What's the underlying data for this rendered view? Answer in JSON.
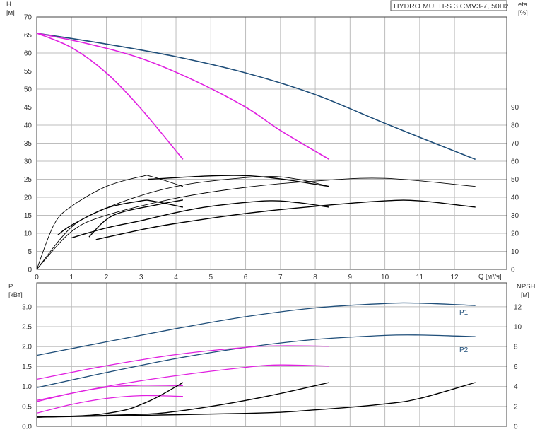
{
  "chart_data": [
    {
      "type": "line",
      "title": "HYDRO MULTI-S 3 CMV3-7, 50Hz",
      "xlabel": "Q [м³/ч]",
      "ylabel_left": "H",
      "ylabel_left_unit": "[м]",
      "ylabel_right": "eta",
      "ylabel_right_unit": "[%]",
      "xlim": [
        0,
        13.5
      ],
      "ylim_left": [
        0,
        70
      ],
      "ylim_right": [
        0,
        140
      ],
      "xticks": [
        "0",
        "1",
        "2",
        "3",
        "4",
        "5",
        "6",
        "7",
        "8",
        "9",
        "10",
        "11",
        "12"
      ],
      "yticks_left": [
        "0",
        "5",
        "10",
        "15",
        "20",
        "25",
        "30",
        "35",
        "40",
        "45",
        "50",
        "55",
        "60",
        "65",
        "70"
      ],
      "yticks_right": [
        "0",
        "10",
        "20",
        "30",
        "40",
        "50",
        "60",
        "70",
        "80",
        "90"
      ],
      "grid": true,
      "series": [
        {
          "kind": "head",
          "color": "#1f4e79",
          "x": [
            0,
            2,
            4,
            6,
            8,
            10,
            12.6
          ],
          "y": [
            65.5,
            62.5,
            59,
            54.5,
            48.5,
            40.5,
            30.5
          ]
        },
        {
          "kind": "head",
          "color": "#e020e0",
          "x": [
            0,
            1.5,
            3,
            4.5,
            6,
            7,
            8.4
          ],
          "y": [
            65.5,
            62.5,
            58.5,
            52.5,
            45,
            38.5,
            30.5
          ]
        },
        {
          "kind": "head",
          "color": "#e020e0",
          "x": [
            0,
            1,
            2,
            3,
            4.2
          ],
          "y": [
            65.5,
            61.5,
            54.5,
            44.5,
            30.5
          ]
        },
        {
          "kind": "eta",
          "color": "#000000",
          "x": [
            0,
            1,
            2,
            4,
            6,
            8,
            10,
            12.6
          ],
          "y": [
            0,
            21,
            30,
            39.5,
            45.5,
            49,
            50.5,
            46
          ]
        },
        {
          "kind": "eta",
          "color": "#000000",
          "x": [
            0,
            1,
            2,
            3,
            4,
            5,
            6.6,
            7.5,
            8.4
          ],
          "y": [
            0,
            23.5,
            34,
            41,
            46,
            49,
            51.5,
            50,
            46
          ]
        },
        {
          "kind": "eta",
          "color": "#000000",
          "x": [
            0,
            0.5,
            1,
            2,
            3,
            3.3,
            4.2
          ],
          "y": [
            0,
            25,
            35,
            46,
            51.5,
            51.5,
            46
          ]
        },
        {
          "kind": "eta",
          "color": "#000000",
          "x": [
            1.7,
            3,
            4,
            6,
            8,
            10,
            11,
            12.6
          ],
          "y": [
            16.5,
            22,
            25.5,
            31,
            35,
            38,
            38,
            34.5
          ]
        },
        {
          "kind": "eta",
          "color": "#000000",
          "x": [
            1,
            2,
            3,
            4,
            5,
            6.6,
            7.5,
            8.4
          ],
          "y": [
            17.5,
            23,
            27,
            31.5,
            35,
            38,
            37,
            34.5
          ]
        },
        {
          "kind": "eta",
          "color": "#000000",
          "x": [
            0.6,
            1,
            2,
            3,
            3.3,
            4.2
          ],
          "y": [
            19,
            24.5,
            34,
            38,
            38,
            34.5
          ]
        },
        {
          "kind": "eta",
          "color": "#000000",
          "x": [
            1.5,
            2.2,
            3.5,
            4.2
          ],
          "y": [
            18,
            30,
            36,
            38.5
          ]
        },
        {
          "kind": "eta",
          "color": "#000000",
          "x": [
            3.2,
            6,
            8.4
          ],
          "y": [
            50,
            52,
            46
          ]
        }
      ]
    },
    {
      "type": "line",
      "ylabel_left": "P",
      "ylabel_left_unit": "[кВт]",
      "ylabel_right": "NPSH",
      "ylabel_right_unit": "[м]",
      "xlim": [
        0,
        13.5
      ],
      "ylim_left": [
        0,
        3.6
      ],
      "ylim_right": [
        0,
        14.4
      ],
      "yticks_left": [
        "0.0",
        "0.5",
        "1.0",
        "1.5",
        "2.0",
        "2.5",
        "3.0"
      ],
      "yticks_right": [
        "0",
        "2",
        "4",
        "6",
        "8",
        "10",
        "12"
      ],
      "grid": true,
      "curve_labels": [
        "P1",
        "P2"
      ],
      "series": [
        {
          "kind": "power",
          "name": "P1",
          "color": "#1f4e79",
          "x": [
            0,
            2,
            4,
            6,
            8,
            10,
            11,
            12.6
          ],
          "y": [
            1.78,
            2.12,
            2.45,
            2.75,
            2.97,
            3.08,
            3.09,
            3.03
          ]
        },
        {
          "kind": "power",
          "name": "P2",
          "color": "#1f4e79",
          "x": [
            0,
            2,
            4,
            6,
            8,
            10,
            11,
            12.6
          ],
          "y": [
            0.97,
            1.35,
            1.7,
            1.98,
            2.18,
            2.28,
            2.29,
            2.25
          ]
        },
        {
          "kind": "power",
          "color": "#e020e0",
          "x": [
            0,
            2,
            4,
            6,
            7,
            8.4
          ],
          "y": [
            1.18,
            1.52,
            1.8,
            1.98,
            2.02,
            2.01
          ]
        },
        {
          "kind": "power",
          "color": "#e020e0",
          "x": [
            0,
            2,
            4,
            6,
            7,
            8.4
          ],
          "y": [
            0.65,
            1.0,
            1.27,
            1.48,
            1.54,
            1.51
          ]
        },
        {
          "kind": "power",
          "color": "#e020e0",
          "x": [
            0,
            1,
            2,
            3,
            4.2
          ],
          "y": [
            0.62,
            0.83,
            0.98,
            1.03,
            1.02
          ]
        },
        {
          "kind": "power",
          "color": "#e020e0",
          "x": [
            0,
            1,
            2,
            3,
            4.2
          ],
          "y": [
            0.33,
            0.55,
            0.7,
            0.77,
            0.75
          ]
        },
        {
          "kind": "npsh",
          "color": "#000000",
          "x": [
            0,
            6,
            8,
            10,
            11,
            12.6
          ],
          "y": [
            0.92,
            1.3,
            1.65,
            2.25,
            2.8,
            4.4
          ]
        },
        {
          "kind": "npsh",
          "color": "#000000",
          "x": [
            0,
            3,
            4,
            5,
            6,
            7,
            8.4
          ],
          "y": [
            0.92,
            1.2,
            1.5,
            2.0,
            2.6,
            3.3,
            4.4
          ]
        },
        {
          "kind": "npsh",
          "color": "#000000",
          "x": [
            0,
            1.5,
            2.5,
            3,
            3.5,
            4.2
          ],
          "y": [
            0.92,
            1.1,
            1.6,
            2.2,
            3.0,
            4.4
          ]
        }
      ]
    }
  ]
}
